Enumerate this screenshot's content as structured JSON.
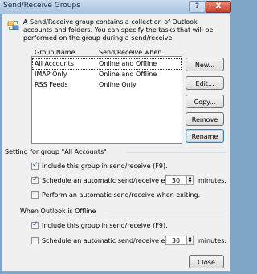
{
  "window": {
    "title": "Send/Receive Groups",
    "help_label": "?",
    "close_label": "X"
  },
  "intro": "A Send/Receive group contains a collection of Outlook accounts and folders. You can specify the tasks that will be performed on the group during a send/receive.",
  "list": {
    "headers": {
      "name": "Group Name",
      "when": "Send/Receive when"
    },
    "rows": [
      {
        "name": "All Accounts",
        "when": "Online and Offline"
      },
      {
        "name": "IMAP Only",
        "when": "Online and Offline"
      },
      {
        "name": "RSS Feeds",
        "when": "Online Only"
      }
    ]
  },
  "buttons": {
    "new": "New...",
    "edit": "Edit...",
    "copy": "Copy...",
    "remove": "Remove",
    "rename": "Rename",
    "close": "Close"
  },
  "settings": {
    "group_title": "Setting for group \"All Accounts\"",
    "include": "Include this group in send/receive (F9).",
    "schedule": "Schedule an automatic send/receive every",
    "schedule_value": "30",
    "minutes": "minutes.",
    "exit": "Perform an automatic send/receive when exiting."
  },
  "offline": {
    "title": "When Outlook is Offline",
    "include": "Include this group in send/receive (F9).",
    "schedule": "Schedule an automatic send/receive every",
    "schedule_value": "30",
    "minutes": "minutes."
  }
}
